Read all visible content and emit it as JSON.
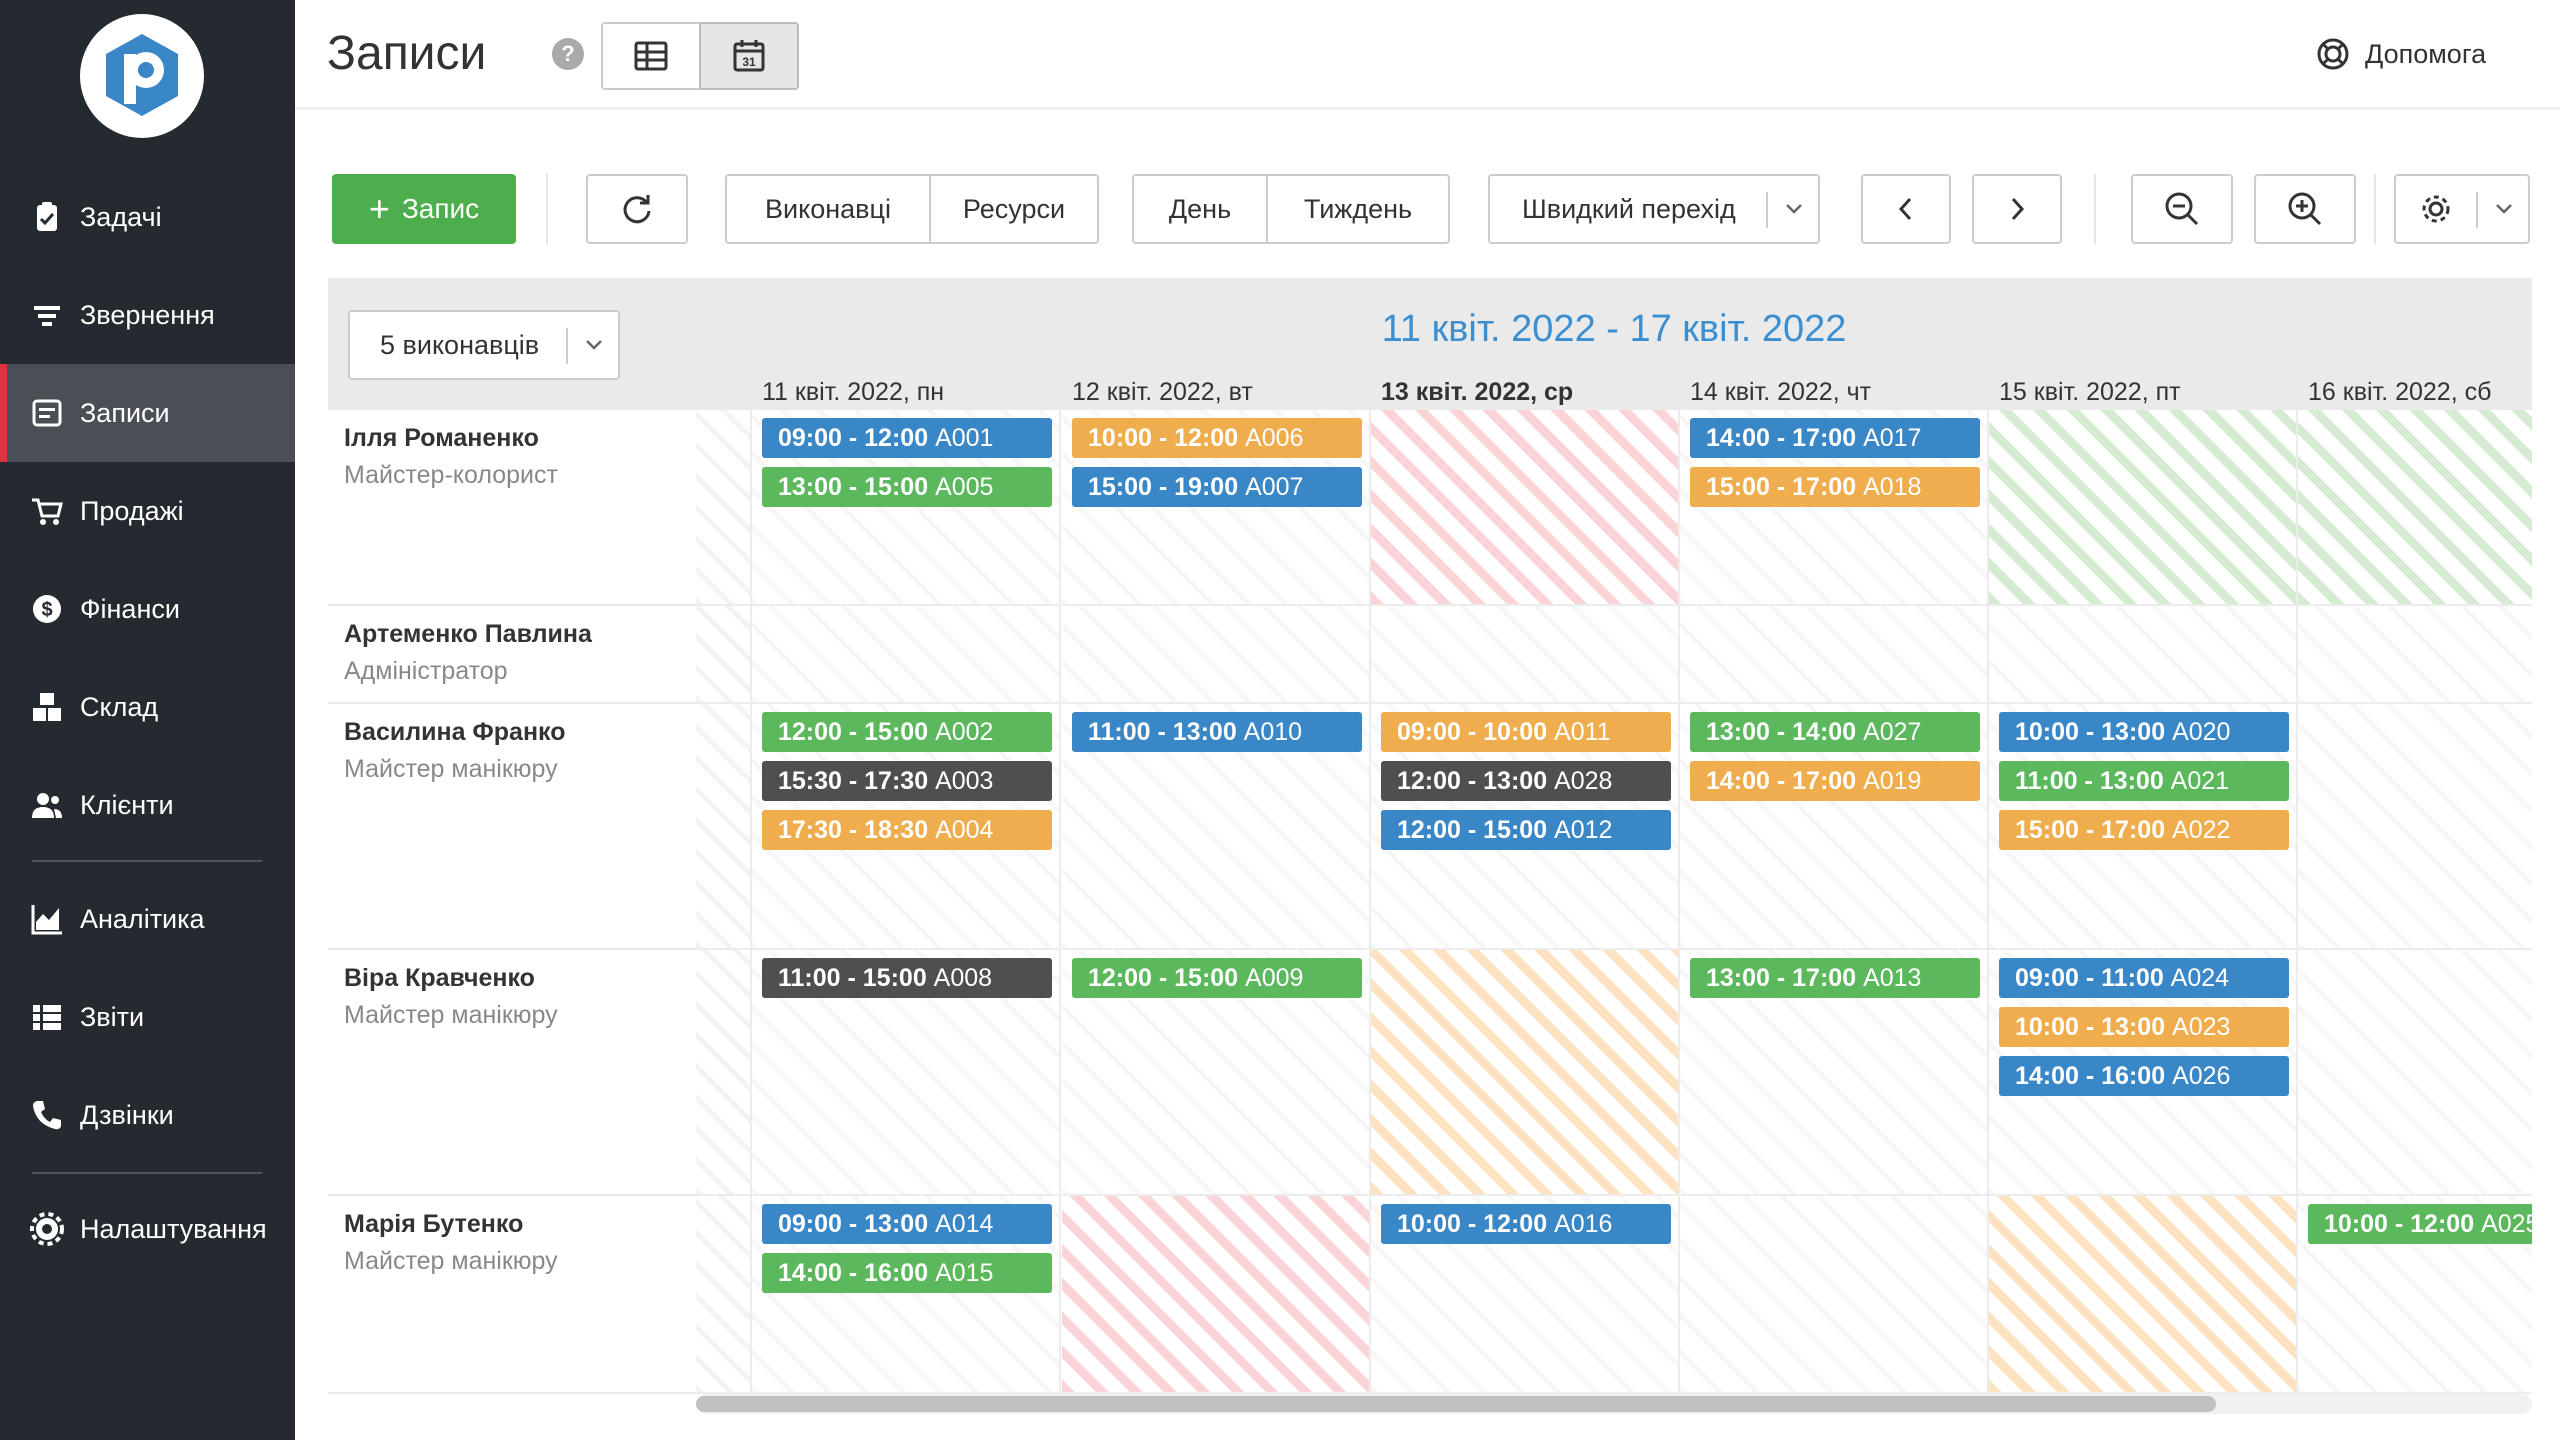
{
  "app": {
    "title": "Записи",
    "help_label": "Допомога",
    "help_q": "?"
  },
  "sidebar": {
    "items": [
      {
        "label": "Задачі",
        "icon": "clipboard-check-icon"
      },
      {
        "label": "Звернення",
        "icon": "filter-icon"
      },
      {
        "label": "Записи",
        "icon": "calendar-list-icon",
        "active": true
      },
      {
        "label": "Продажі",
        "icon": "cart-icon"
      },
      {
        "label": "Фінанси",
        "icon": "dollar-circle-icon"
      },
      {
        "label": "Склад",
        "icon": "boxes-icon"
      },
      {
        "label": "Клієнти",
        "icon": "users-icon"
      },
      {
        "label": "Аналітика",
        "icon": "area-chart-icon"
      },
      {
        "label": "Звіти",
        "icon": "report-list-icon"
      },
      {
        "label": "Дзвінки",
        "icon": "phone-icon"
      },
      {
        "label": "Налаштування",
        "icon": "gear-icon"
      }
    ]
  },
  "toolbar": {
    "add_label": "Запис",
    "performers_label": "Виконавці",
    "resources_label": "Ресурси",
    "day_label": "День",
    "week_label": "Тиждень",
    "quick_jump_label": "Швидкий перехід",
    "calendar_icon_day": "31"
  },
  "calendar": {
    "performers_select": "5 виконавців",
    "week_title": "11 квіт. 2022 - 17 квіт. 2022",
    "days": [
      "11 квіт. 2022, пн",
      "12 квіт. 2022, вт",
      "13 квіт. 2022, ср",
      "14 квіт. 2022, чт",
      "15 квіт. 2022, пт",
      "16 квіт. 2022, сб"
    ],
    "today_index": 2,
    "resources": [
      {
        "name": "Ілля Романенко",
        "role": "Майстер-колорист",
        "days": [
          {
            "state": "normal",
            "events": [
              {
                "time": "09:00 - 12:00",
                "code": "A001",
                "color": "blue"
              },
              {
                "time": "13:00 - 15:00",
                "code": "A005",
                "color": "green"
              }
            ]
          },
          {
            "state": "normal",
            "events": [
              {
                "time": "10:00 - 12:00",
                "code": "A006",
                "color": "orange"
              },
              {
                "time": "15:00 - 19:00",
                "code": "A007",
                "color": "blue"
              }
            ]
          },
          {
            "state": "off-red",
            "events": []
          },
          {
            "state": "normal",
            "events": [
              {
                "time": "14:00 - 17:00",
                "code": "A017",
                "color": "blue"
              },
              {
                "time": "15:00 - 17:00",
                "code": "A018",
                "color": "orange"
              }
            ]
          },
          {
            "state": "off-green",
            "events": []
          },
          {
            "state": "off-green",
            "events": []
          }
        ]
      },
      {
        "name": "Артеменко Павлина",
        "role": "Адміністратор",
        "days": [
          {
            "state": "normal",
            "events": []
          },
          {
            "state": "normal",
            "events": []
          },
          {
            "state": "normal",
            "events": []
          },
          {
            "state": "normal",
            "events": []
          },
          {
            "state": "normal",
            "events": []
          },
          {
            "state": "normal",
            "events": []
          }
        ]
      },
      {
        "name": "Василина Франко",
        "role": "Майстер манікюру",
        "days": [
          {
            "state": "normal",
            "events": [
              {
                "time": "12:00 - 15:00",
                "code": "A002",
                "color": "green"
              },
              {
                "time": "15:30 - 17:30",
                "code": "A003",
                "color": "dark"
              },
              {
                "time": "17:30 - 18:30",
                "code": "A004",
                "color": "orange"
              }
            ]
          },
          {
            "state": "normal",
            "events": [
              {
                "time": "11:00 - 13:00",
                "code": "A010",
                "color": "blue"
              }
            ]
          },
          {
            "state": "normal",
            "events": [
              {
                "time": "09:00 - 10:00",
                "code": "A011",
                "color": "orange"
              },
              {
                "time": "12:00 - 13:00",
                "code": "A028",
                "color": "dark"
              },
              {
                "time": "12:00 - 15:00",
                "code": "A012",
                "color": "blue"
              }
            ]
          },
          {
            "state": "normal",
            "events": [
              {
                "time": "13:00 - 14:00",
                "code": "A027",
                "color": "green"
              },
              {
                "time": "14:00 - 17:00",
                "code": "A019",
                "color": "orange"
              }
            ]
          },
          {
            "state": "normal",
            "events": [
              {
                "time": "10:00 - 13:00",
                "code": "A020",
                "color": "blue"
              },
              {
                "time": "11:00 - 13:00",
                "code": "A021",
                "color": "green"
              },
              {
                "time": "15:00 - 17:00",
                "code": "A022",
                "color": "orange"
              }
            ]
          },
          {
            "state": "normal",
            "events": []
          }
        ]
      },
      {
        "name": "Віра Кравченко",
        "role": "Майстер манікюру",
        "days": [
          {
            "state": "normal",
            "events": [
              {
                "time": "11:00 - 15:00",
                "code": "A008",
                "color": "dark"
              }
            ]
          },
          {
            "state": "normal",
            "events": [
              {
                "time": "12:00 - 15:00",
                "code": "A009",
                "color": "green"
              }
            ]
          },
          {
            "state": "off-orange",
            "events": []
          },
          {
            "state": "normal",
            "events": [
              {
                "time": "13:00 - 17:00",
                "code": "A013",
                "color": "green"
              }
            ]
          },
          {
            "state": "normal",
            "events": [
              {
                "time": "09:00 - 11:00",
                "code": "A024",
                "color": "blue"
              },
              {
                "time": "10:00 - 13:00",
                "code": "A023",
                "color": "orange"
              },
              {
                "time": "14:00 - 16:00",
                "code": "A026",
                "color": "blue"
              }
            ]
          },
          {
            "state": "normal",
            "events": []
          }
        ]
      },
      {
        "name": "Марія Бутенко",
        "role": "Майстер манікюру",
        "days": [
          {
            "state": "normal",
            "events": [
              {
                "time": "09:00 - 13:00",
                "code": "A014",
                "color": "blue"
              },
              {
                "time": "14:00 - 16:00",
                "code": "A015",
                "color": "green"
              }
            ]
          },
          {
            "state": "off-red",
            "events": []
          },
          {
            "state": "normal",
            "events": [
              {
                "time": "10:00 - 12:00",
                "code": "A016",
                "color": "blue"
              }
            ]
          },
          {
            "state": "normal",
            "events": []
          },
          {
            "state": "off-orange",
            "events": []
          },
          {
            "state": "normal",
            "events": [
              {
                "time": "10:00 - 12:00",
                "code": "A025",
                "color": "green"
              }
            ]
          }
        ]
      }
    ]
  },
  "colors": {
    "sidebar_bg": "#252a30",
    "active_marker": "#e0313f",
    "accent_blue": "#3a87c8",
    "accent_green": "#5cb85c",
    "accent_orange": "#f0ad4e",
    "event_dark": "#4f4f4f",
    "title_blue": "#3b8fd1"
  }
}
